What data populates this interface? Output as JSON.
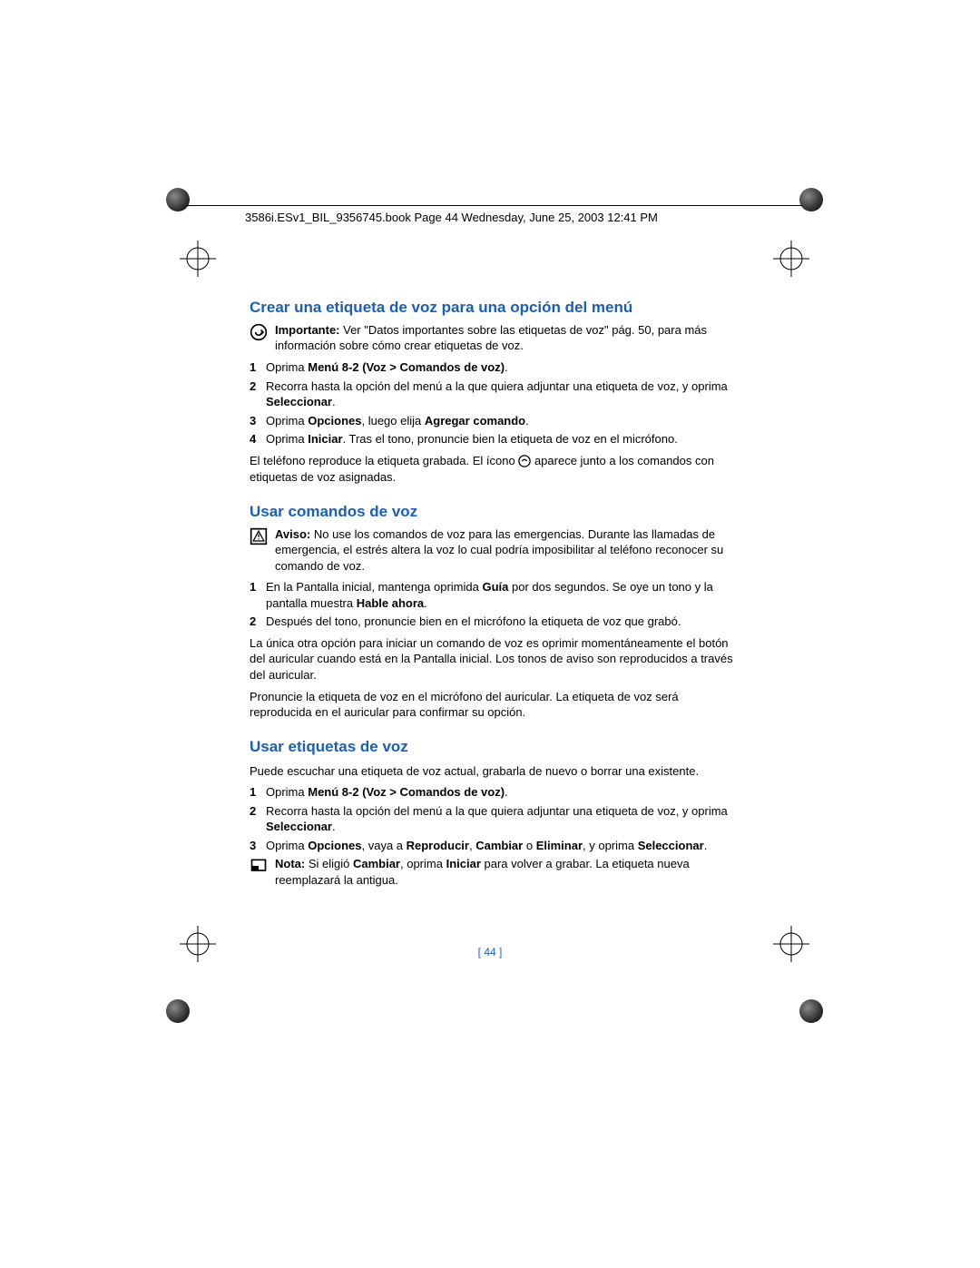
{
  "header": "3586i.ESv1_BIL_9356745.book  Page 44  Wednesday, June 25, 2003  12:41 PM",
  "page_number": "[ 44 ]",
  "section1": {
    "title": "Crear una etiqueta de voz para una opción del menú",
    "important_label": "Importante:",
    "important_text": " Ver \"Datos importantes sobre las etiquetas de voz\" pág. 50, para más información sobre cómo crear etiquetas de voz.",
    "step1_pre": "Oprima ",
    "step1_bold": "Menú 8-2 (Voz > Comandos de voz)",
    "step1_post": ".",
    "step2_pre": "Recorra hasta la opción del menú a la que quiera adjuntar una etiqueta de voz, y oprima ",
    "step2_bold": "Seleccionar",
    "step2_post": ".",
    "step3_pre": "Oprima ",
    "step3_bold1": "Opciones",
    "step3_mid": ", luego elija ",
    "step3_bold2": "Agregar comando",
    "step3_post": ".",
    "step4_pre": "Oprima ",
    "step4_bold": "Iniciar",
    "step4_post": ". Tras el tono, pronuncie bien la etiqueta de voz en el micrófono.",
    "para1_pre": "El teléfono reproduce la etiqueta grabada. El ícono ",
    "para1_post": " aparece junto a los comandos con etiquetas de voz asignadas."
  },
  "section2": {
    "title": "Usar comandos de voz",
    "warn_label": "Aviso:",
    "warn_text": " No use los comandos de voz para las emergencias. Durante las llamadas de emergencia, el estrés altera la voz lo cual podría imposibilitar al teléfono reconocer su comando de voz.",
    "step1_pre": "En la Pantalla inicial, mantenga oprimida ",
    "step1_bold1": "Guía",
    "step1_mid": " por dos segundos. Se oye un tono y la pantalla muestra ",
    "step1_bold2": "Hable ahora",
    "step1_post": ".",
    "step2": "Después del tono, pronuncie bien en el micrófono la etiqueta de voz que grabó.",
    "para1": "La única otra opción para iniciar un comando de voz es oprimir momentáneamente el botón del auricular cuando está en la Pantalla inicial. Los tonos de aviso son reproducidos a través del auricular.",
    "para2": "Pronuncie la etiqueta de voz en el micrófono del auricular. La etiqueta de voz será reproducida en el auricular para confirmar su opción."
  },
  "section3": {
    "title": "Usar etiquetas de voz",
    "intro": "Puede escuchar una etiqueta de voz actual, grabarla de nuevo o borrar una existente.",
    "step1_pre": "Oprima ",
    "step1_bold": "Menú 8-2 (Voz > Comandos de voz)",
    "step1_post": ".",
    "step2_pre": "Recorra hasta la opción del menú a la que quiera adjuntar una etiqueta de voz, y oprima ",
    "step2_bold": "Seleccionar",
    "step2_post": ".",
    "step3_pre": "Oprima ",
    "step3_bold1": "Opciones",
    "step3_mid1": ", vaya a ",
    "step3_bold2": "Reproducir",
    "step3_mid2": ", ",
    "step3_bold3": "Cambiar",
    "step3_mid3": " o ",
    "step3_bold4": "Eliminar",
    "step3_mid4": ", y oprima ",
    "step3_bold5": "Seleccionar",
    "step3_post": ".",
    "note_label": "Nota:",
    "note_pre": " Si eligió ",
    "note_bold1": "Cambiar",
    "note_mid": ", oprima ",
    "note_bold2": "Iniciar",
    "note_post": " para volver a grabar. La etiqueta nueva reemplazará la antigua."
  },
  "numbers": {
    "n1": "1",
    "n2": "2",
    "n3": "3",
    "n4": "4"
  }
}
